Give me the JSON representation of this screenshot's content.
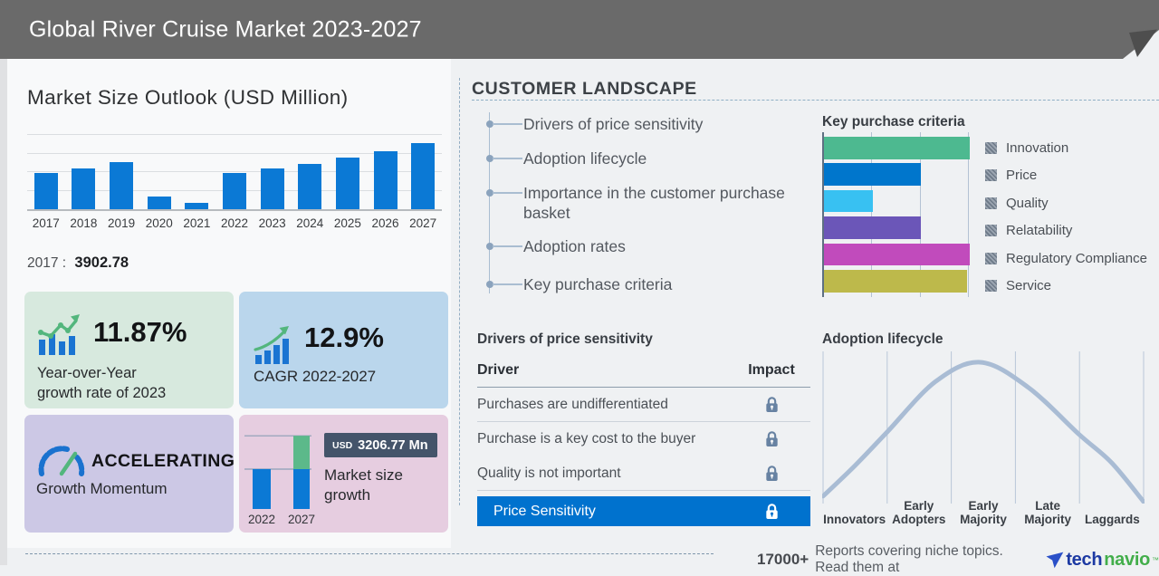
{
  "header": {
    "title": "Global River Cruise Market 2023-2027"
  },
  "market_outlook": {
    "title": "Market Size Outlook (USD Million)",
    "callout": {
      "year": "2017",
      "separator": ":",
      "value": "3902.78"
    }
  },
  "stats": {
    "yoy": {
      "value": "11.87%",
      "label_line1": "Year-over-Year",
      "label_line2": "growth rate of 2023",
      "icon": "bar-chart-trend-icon"
    },
    "cagr": {
      "value": "12.9%",
      "label": "CAGR 2022-2027",
      "icon": "growth-bars-arrow-icon"
    },
    "momentum": {
      "value": "ACCELERATING",
      "label": "Growth Momentum",
      "icon": "gauge-icon"
    },
    "growth": {
      "badge_currency": "USD",
      "badge_value": "3206.77 Mn",
      "label": "Market size growth",
      "icon": "stacked-growth-bars-icon"
    }
  },
  "customer_landscape": {
    "title": "CUSTOMER LANDSCAPE",
    "items": [
      "Drivers of price sensitivity",
      "Adoption lifecycle",
      "Importance in the customer purchase basket",
      "Adoption rates",
      "Key purchase criteria"
    ]
  },
  "drivers_table": {
    "title": "Drivers of price sensitivity",
    "columns": [
      "Driver",
      "Impact"
    ],
    "rows": [
      "Purchases are undifferentiated",
      "Purchase is a key cost to the buyer",
      "Quality is not important"
    ],
    "highlight_row": "Price Sensitivity",
    "impact_icon": "lock-icon"
  },
  "footer": {
    "count": "17000+",
    "text": "Reports covering niche topics. Read them at",
    "brand_prefix": "tech",
    "brand_suffix": "navio",
    "brand_icon": "technavio-arrow-icon"
  },
  "colors": {
    "header_bg": "#6a6a6a",
    "bar_blue": "#0b79d5",
    "accent_green": "#53b67d",
    "highlight_blue": "#0072ce",
    "badge_slate": "#44546a",
    "lock_gray_blue": "#6782a2",
    "lifecycle_curve": "#a9bcd4"
  },
  "chart_data": [
    {
      "id": "market_size_outlook",
      "type": "bar",
      "title": "Market Size Outlook (USD Million)",
      "categories": [
        "2017",
        "2018",
        "2019",
        "2020",
        "2021",
        "2022",
        "2023",
        "2024",
        "2025",
        "2026",
        "2027"
      ],
      "values": [
        3902.78,
        4340,
        4980,
        1360,
        660,
        3838,
        4294,
        4850,
        5480,
        6210,
        7045
      ],
      "ylim": [
        0,
        8000
      ],
      "grid": true,
      "bar_color": "#0b79d5",
      "note": "2017 labeled 3902.78; remaining values estimated from bar heights vs gridlines"
    },
    {
      "id": "market_size_growth",
      "type": "bar",
      "categories": [
        "2022",
        "2027"
      ],
      "values": [
        3838,
        7044.77
      ],
      "delta_label": "USD 3206.77 Mn",
      "base_color": "#0b79d5",
      "delta_color": "#5cb98a"
    },
    {
      "id": "key_purchase_criteria",
      "type": "bar",
      "orientation": "horizontal",
      "title": "Key purchase criteria",
      "categories": [
        "Innovation",
        "Price",
        "Quality",
        "Relatability",
        "Regulatory Compliance",
        "Service"
      ],
      "values": [
        3,
        2,
        1,
        2,
        3,
        2.95
      ],
      "xlim": [
        0,
        3
      ],
      "grid": true,
      "colors": [
        "#4db990",
        "#0076cc",
        "#38c1f2",
        "#6b56b8",
        "#c14bbc",
        "#bdb94b"
      ],
      "legend_position": "right",
      "note": "relative importance on unlabeled 0-3 scale"
    },
    {
      "id": "adoption_lifecycle",
      "type": "line",
      "title": "Adoption lifecycle",
      "categories": [
        "Innovators",
        "Early Adopters",
        "Early Majority",
        "Late Majority",
        "Laggards"
      ],
      "values": [
        0.25,
        0.72,
        1.0,
        0.62,
        0.12
      ],
      "curve_points": [
        [
          0,
          0.04
        ],
        [
          0.1,
          0.26
        ],
        [
          0.2,
          0.5
        ],
        [
          0.35,
          0.86
        ],
        [
          0.49,
          1.0
        ],
        [
          0.64,
          0.82
        ],
        [
          0.8,
          0.48
        ],
        [
          0.9,
          0.28
        ],
        [
          1,
          0.0
        ]
      ],
      "line_color": "#a9bcd4",
      "note": "bell-shaped adoption curve peaking near Early Majority"
    }
  ]
}
